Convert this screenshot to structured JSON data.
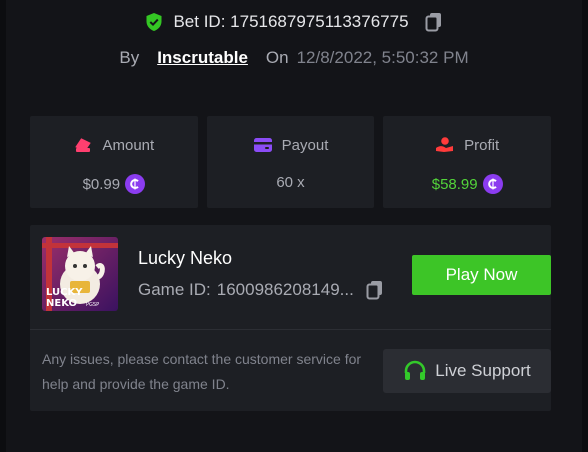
{
  "header": {
    "bet_id_label": "Bet ID:",
    "bet_id": "1751687975113376775",
    "by_label": "By",
    "user": "Inscrutable",
    "on_label": "On",
    "date": "12/8/2022, 5:50:32 PM"
  },
  "stats": [
    {
      "label": "Amount",
      "value": "$0.99",
      "icon": "amount-icon",
      "has_coin": true
    },
    {
      "label": "Payout",
      "value": "60 x",
      "icon": "wallet-icon",
      "has_coin": false
    },
    {
      "label": "Profit",
      "value": "$58.99",
      "icon": "profit-icon",
      "has_coin": true
    }
  ],
  "game": {
    "title": "Lucky Neko",
    "game_id_label": "Game ID:",
    "game_id": "1600986208149...",
    "play_label": "Play Now",
    "thumb_text_top": "LUCKY",
    "thumb_text_bottom": "NEKO",
    "thumb_badge": "PGSP",
    "help_text": "Any issues, please contact the customer service for help and provide the game ID.",
    "support_label": "Live Support"
  },
  "colors": {
    "accent_green": "#3dc527",
    "profit_green": "#53d43a",
    "coin_purple": "#8b3cf0"
  }
}
